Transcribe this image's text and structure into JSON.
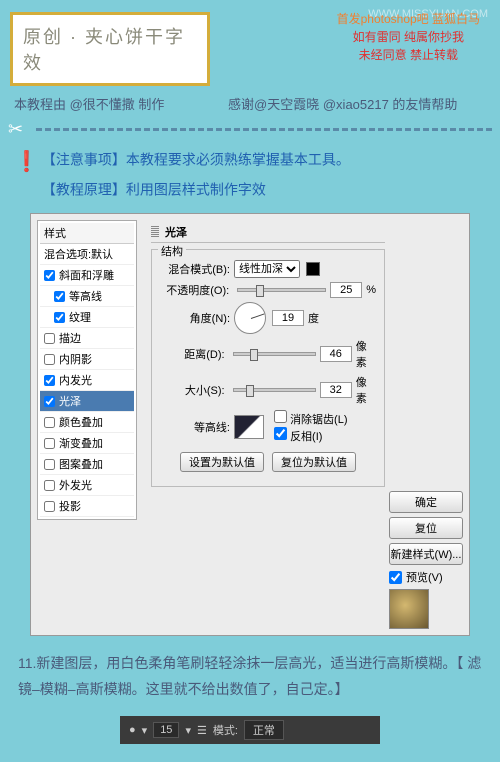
{
  "watermark": "WWW.MISSYUAN.COM",
  "header": {
    "title": "原创 · 夹心饼干字效"
  },
  "red_lines": {
    "l1": "首发photoshop吧  蓝狐白马",
    "l2": "如有雷同  纯属你抄我",
    "l3": "未经同意  禁止转载"
  },
  "credits": {
    "left": "本教程由 @很不懂撒 制作",
    "right": "感谢@天空霞晓  @xiao5217 的友情帮助"
  },
  "instructions": {
    "line1": "【注意事项】本教程要求必须熟练掌握基本工具。",
    "line2": "【教程原理】利用图层样式制作字效"
  },
  "dialog": {
    "styles_header": "样式",
    "blend_options": "混合选项:默认",
    "items": [
      {
        "label": "斜面和浮雕",
        "checked": true
      },
      {
        "label": "等高线",
        "checked": true,
        "sub": true
      },
      {
        "label": "纹理",
        "checked": true,
        "sub": true
      },
      {
        "label": "描边",
        "checked": false
      },
      {
        "label": "内阴影",
        "checked": false
      },
      {
        "label": "内发光",
        "checked": true
      },
      {
        "label": "光泽",
        "checked": true,
        "selected": true
      },
      {
        "label": "颜色叠加",
        "checked": false
      },
      {
        "label": "渐变叠加",
        "checked": false
      },
      {
        "label": "图案叠加",
        "checked": false
      },
      {
        "label": "外发光",
        "checked": false
      },
      {
        "label": "投影",
        "checked": false
      }
    ],
    "panel_title": "光泽",
    "struct_title": "结构",
    "blend_label": "混合模式(B):",
    "blend_value": "线性加深",
    "opacity_label": "不透明度(O):",
    "opacity_value": "25",
    "opacity_unit": "%",
    "angle_label": "角度(N):",
    "angle_value": "19",
    "angle_unit": "度",
    "distance_label": "距离(D):",
    "distance_value": "46",
    "distance_unit": "像素",
    "size_label": "大小(S):",
    "size_value": "32",
    "size_unit": "像素",
    "contour_label": "等高线:",
    "antialias_label": "消除锯齿(L)",
    "invert_label": "反相(I)",
    "btn_default": "设置为默认值",
    "btn_reset": "复位为默认值",
    "btn_ok": "确定",
    "btn_cancel": "复位",
    "btn_newstyle": "新建样式(W)...",
    "preview_label": "预览(V)"
  },
  "step_text": "11.新建图层，用白色柔角笔刷轻轻涂抹一层高光，适当进行高斯模糊。【 滤镜–模糊–高斯模糊。这里就不给出数值了，自己定。】",
  "toolbar": {
    "size": "15",
    "mode_label": "模式:",
    "mode_value": "正常"
  }
}
